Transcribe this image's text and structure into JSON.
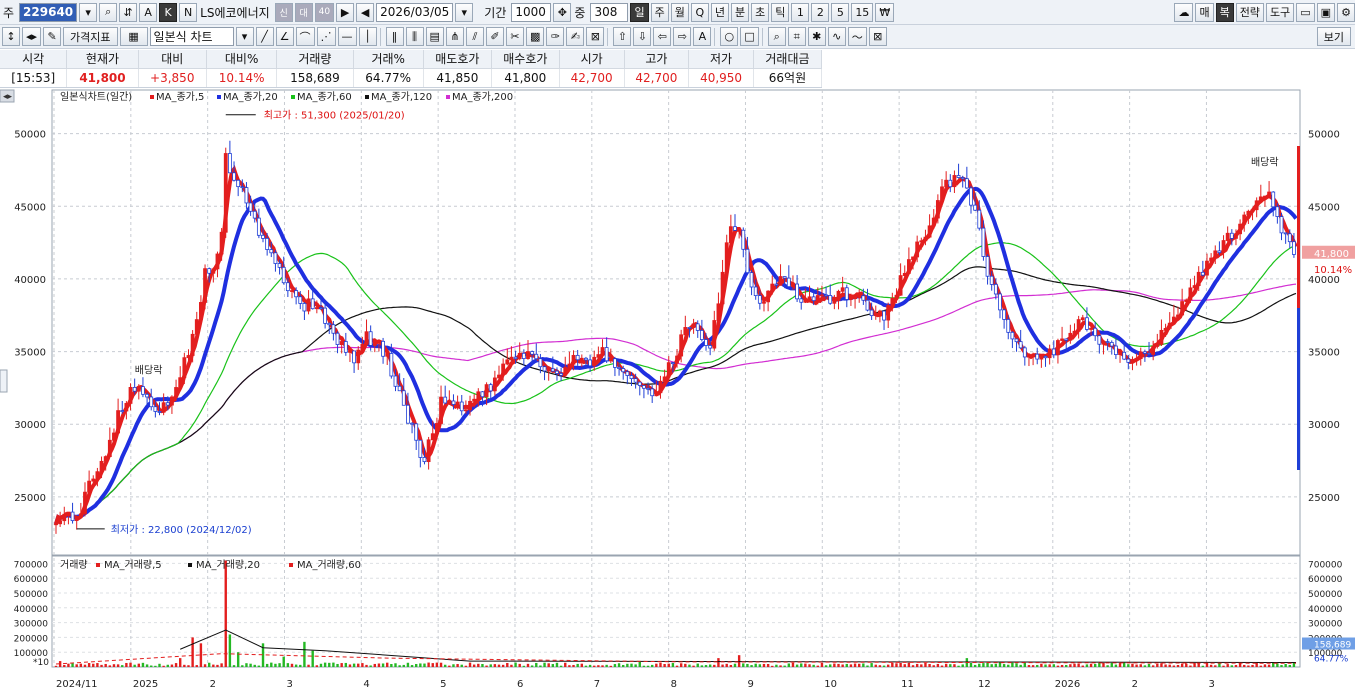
{
  "toolbar1": {
    "label_code": "주",
    "code": "229640",
    "opts": [
      "A",
      "K",
      "N"
    ],
    "active_opt": "K",
    "stock_name": "LS에코에너지",
    "tags": [
      "신",
      "대",
      "40"
    ],
    "date": "2026/03/05",
    "period_label": "기간",
    "period_value": "1000",
    "count_label": "중",
    "count_value": "308",
    "timeframes": [
      "일",
      "주",
      "월",
      "Q",
      "년",
      "분",
      "초",
      "틱",
      "1",
      "2",
      "5",
      "15",
      "₩"
    ],
    "active_tf": "일",
    "right": [
      "매",
      "복",
      "전략",
      "도구",
      "보기"
    ]
  },
  "toolbar2": {
    "price_indicator": "가격지표",
    "chart_type": "일본식 차트"
  },
  "quote": {
    "headers": [
      "시각",
      "현재가",
      "대비",
      "대비%",
      "거래량",
      "거래%",
      "매도호가",
      "매수호가",
      "시가",
      "고가",
      "저가",
      "거래대금"
    ],
    "values": [
      "[15:53]",
      "41,800",
      "+3,850",
      "10.14%",
      "158,689",
      "64.77%",
      "41,850",
      "41,800",
      "42,700",
      "42,700",
      "40,950",
      "66억원"
    ]
  },
  "colors": {
    "up": "#e31e1e",
    "down": "#1f3fd6",
    "ma5": "#e31e1e",
    "ma20": "#1f2fe0",
    "ma60": "#19c219",
    "ma120": "#111111",
    "ma200": "#d22ed2"
  },
  "chart_data": {
    "type": "candlestick",
    "title": "일본식차트(일간)",
    "legend": [
      {
        "name": "MA_종가,5",
        "color": "#e31e1e"
      },
      {
        "name": "MA_종가,20",
        "color": "#1f2fe0"
      },
      {
        "name": "MA_종가,60",
        "color": "#19c219"
      },
      {
        "name": "MA_종가,120",
        "color": "#111111"
      },
      {
        "name": "MA_종가,200",
        "color": "#d22ed2"
      }
    ],
    "ylim": [
      21000,
      53000
    ],
    "y_ticks": [
      25000,
      30000,
      35000,
      40000,
      45000,
      50000
    ],
    "x_labels": [
      "2024/11",
      "2025",
      "2",
      "3",
      "4",
      "5",
      "6",
      "7",
      "8",
      "9",
      "10",
      "11",
      "12",
      "2026",
      "2",
      "3"
    ],
    "annotations": {
      "high": "최고가 : 51,300 (2025/01/20)",
      "low": "최저가 : 22,800 (2024/12/02)",
      "dividend": "배당락"
    },
    "current_price": "41,800",
    "current_change": "10.14%",
    "close_path": [
      [
        0,
        23600
      ],
      [
        5,
        24000
      ],
      [
        10,
        23200
      ],
      [
        15,
        25500
      ],
      [
        20,
        26500
      ],
      [
        25,
        28500
      ],
      [
        30,
        30500
      ],
      [
        35,
        32000
      ],
      [
        40,
        32500
      ],
      [
        45,
        31500
      ],
      [
        50,
        31000
      ],
      [
        55,
        31500
      ],
      [
        60,
        33500
      ],
      [
        65,
        35500
      ],
      [
        70,
        38500
      ],
      [
        72,
        41000
      ],
      [
        75,
        40500
      ],
      [
        80,
        43000
      ],
      [
        82,
        49000
      ],
      [
        85,
        47000
      ],
      [
        90,
        46000
      ],
      [
        95,
        44000
      ],
      [
        100,
        43000
      ],
      [
        105,
        41500
      ],
      [
        110,
        40000
      ],
      [
        115,
        39000
      ],
      [
        120,
        38000
      ],
      [
        125,
        38500
      ],
      [
        130,
        37000
      ],
      [
        135,
        36000
      ],
      [
        140,
        35000
      ],
      [
        145,
        34500
      ],
      [
        150,
        36000
      ],
      [
        155,
        35500
      ],
      [
        160,
        34500
      ],
      [
        165,
        32500
      ],
      [
        170,
        30500
      ],
      [
        175,
        28500
      ],
      [
        178,
        27000
      ],
      [
        180,
        28500
      ],
      [
        183,
        29500
      ],
      [
        185,
        31500
      ],
      [
        190,
        31500
      ],
      [
        195,
        31000
      ],
      [
        200,
        31500
      ],
      [
        205,
        32000
      ],
      [
        210,
        32500
      ],
      [
        215,
        33500
      ],
      [
        220,
        34500
      ],
      [
        225,
        35000
      ],
      [
        230,
        34500
      ],
      [
        235,
        34000
      ],
      [
        240,
        33500
      ],
      [
        245,
        33500
      ],
      [
        250,
        34500
      ],
      [
        255,
        34000
      ],
      [
        260,
        34500
      ],
      [
        265,
        35000
      ],
      [
        270,
        34000
      ],
      [
        275,
        33500
      ],
      [
        280,
        33000
      ],
      [
        285,
        32500
      ],
      [
        290,
        32000
      ],
      [
        295,
        33500
      ],
      [
        300,
        35000
      ],
      [
        305,
        37000
      ],
      [
        310,
        36500
      ],
      [
        315,
        35000
      ],
      [
        320,
        38000
      ],
      [
        325,
        43500
      ],
      [
        330,
        43000
      ],
      [
        335,
        40000
      ],
      [
        340,
        38000
      ],
      [
        345,
        39500
      ],
      [
        350,
        40000
      ],
      [
        355,
        39500
      ],
      [
        360,
        38500
      ],
      [
        365,
        38500
      ],
      [
        370,
        38500
      ],
      [
        375,
        38500
      ],
      [
        380,
        39000
      ],
      [
        385,
        39000
      ],
      [
        390,
        38500
      ],
      [
        395,
        37500
      ],
      [
        400,
        37500
      ],
      [
        405,
        39000
      ],
      [
        410,
        40500
      ],
      [
        415,
        42000
      ],
      [
        420,
        43000
      ],
      [
        425,
        45000
      ],
      [
        430,
        46500
      ],
      [
        435,
        47000
      ],
      [
        440,
        46500
      ],
      [
        445,
        44000
      ],
      [
        450,
        40000
      ],
      [
        455,
        38500
      ],
      [
        460,
        36500
      ],
      [
        465,
        35000
      ],
      [
        470,
        34500
      ],
      [
        475,
        34500
      ],
      [
        480,
        35000
      ],
      [
        485,
        35500
      ],
      [
        490,
        36000
      ],
      [
        495,
        37000
      ],
      [
        500,
        36500
      ],
      [
        505,
        35500
      ],
      [
        510,
        35000
      ],
      [
        515,
        34500
      ],
      [
        520,
        34500
      ],
      [
        525,
        34800
      ],
      [
        530,
        35500
      ],
      [
        535,
        36500
      ],
      [
        540,
        37500
      ],
      [
        545,
        38500
      ],
      [
        550,
        39500
      ],
      [
        555,
        41000
      ],
      [
        560,
        41500
      ],
      [
        565,
        42500
      ],
      [
        570,
        43500
      ],
      [
        575,
        44500
      ],
      [
        580,
        45500
      ],
      [
        585,
        46000
      ],
      [
        590,
        44000
      ],
      [
        595,
        42500
      ],
      [
        598,
        41800
      ]
    ],
    "volume": {
      "title": "거래량",
      "legend": [
        {
          "name": "MA_거래량,5",
          "color": "#e31e1e"
        },
        {
          "name": "MA_거래량,20",
          "color": "#111111"
        },
        {
          "name": "MA_거래량,60",
          "color": "#e31e1e"
        }
      ],
      "ylim": [
        0,
        750000
      ],
      "y_ticks": [
        100000,
        200000,
        300000,
        400000,
        500000,
        600000,
        700000
      ],
      "current": "158,689",
      "current_pct": "64.77%",
      "scale_label": "*10",
      "spikes": [
        [
          2,
          40000
        ],
        [
          8,
          25000
        ],
        [
          60,
          60000
        ],
        [
          66,
          200000
        ],
        [
          70,
          160000
        ],
        [
          82,
          720000
        ],
        [
          84,
          220000
        ],
        [
          88,
          100000
        ],
        [
          95,
          170000
        ],
        [
          100,
          160000
        ],
        [
          110,
          70000
        ],
        [
          115,
          140000
        ],
        [
          120,
          170000
        ],
        [
          124,
          110000
        ],
        [
          180,
          30000
        ],
        [
          282,
          40000
        ],
        [
          320,
          60000
        ],
        [
          330,
          80000
        ],
        [
          433,
          210000
        ],
        [
          435,
          100000
        ],
        [
          440,
          60000
        ],
        [
          575,
          30000
        ],
        [
          595,
          40000
        ]
      ]
    }
  }
}
